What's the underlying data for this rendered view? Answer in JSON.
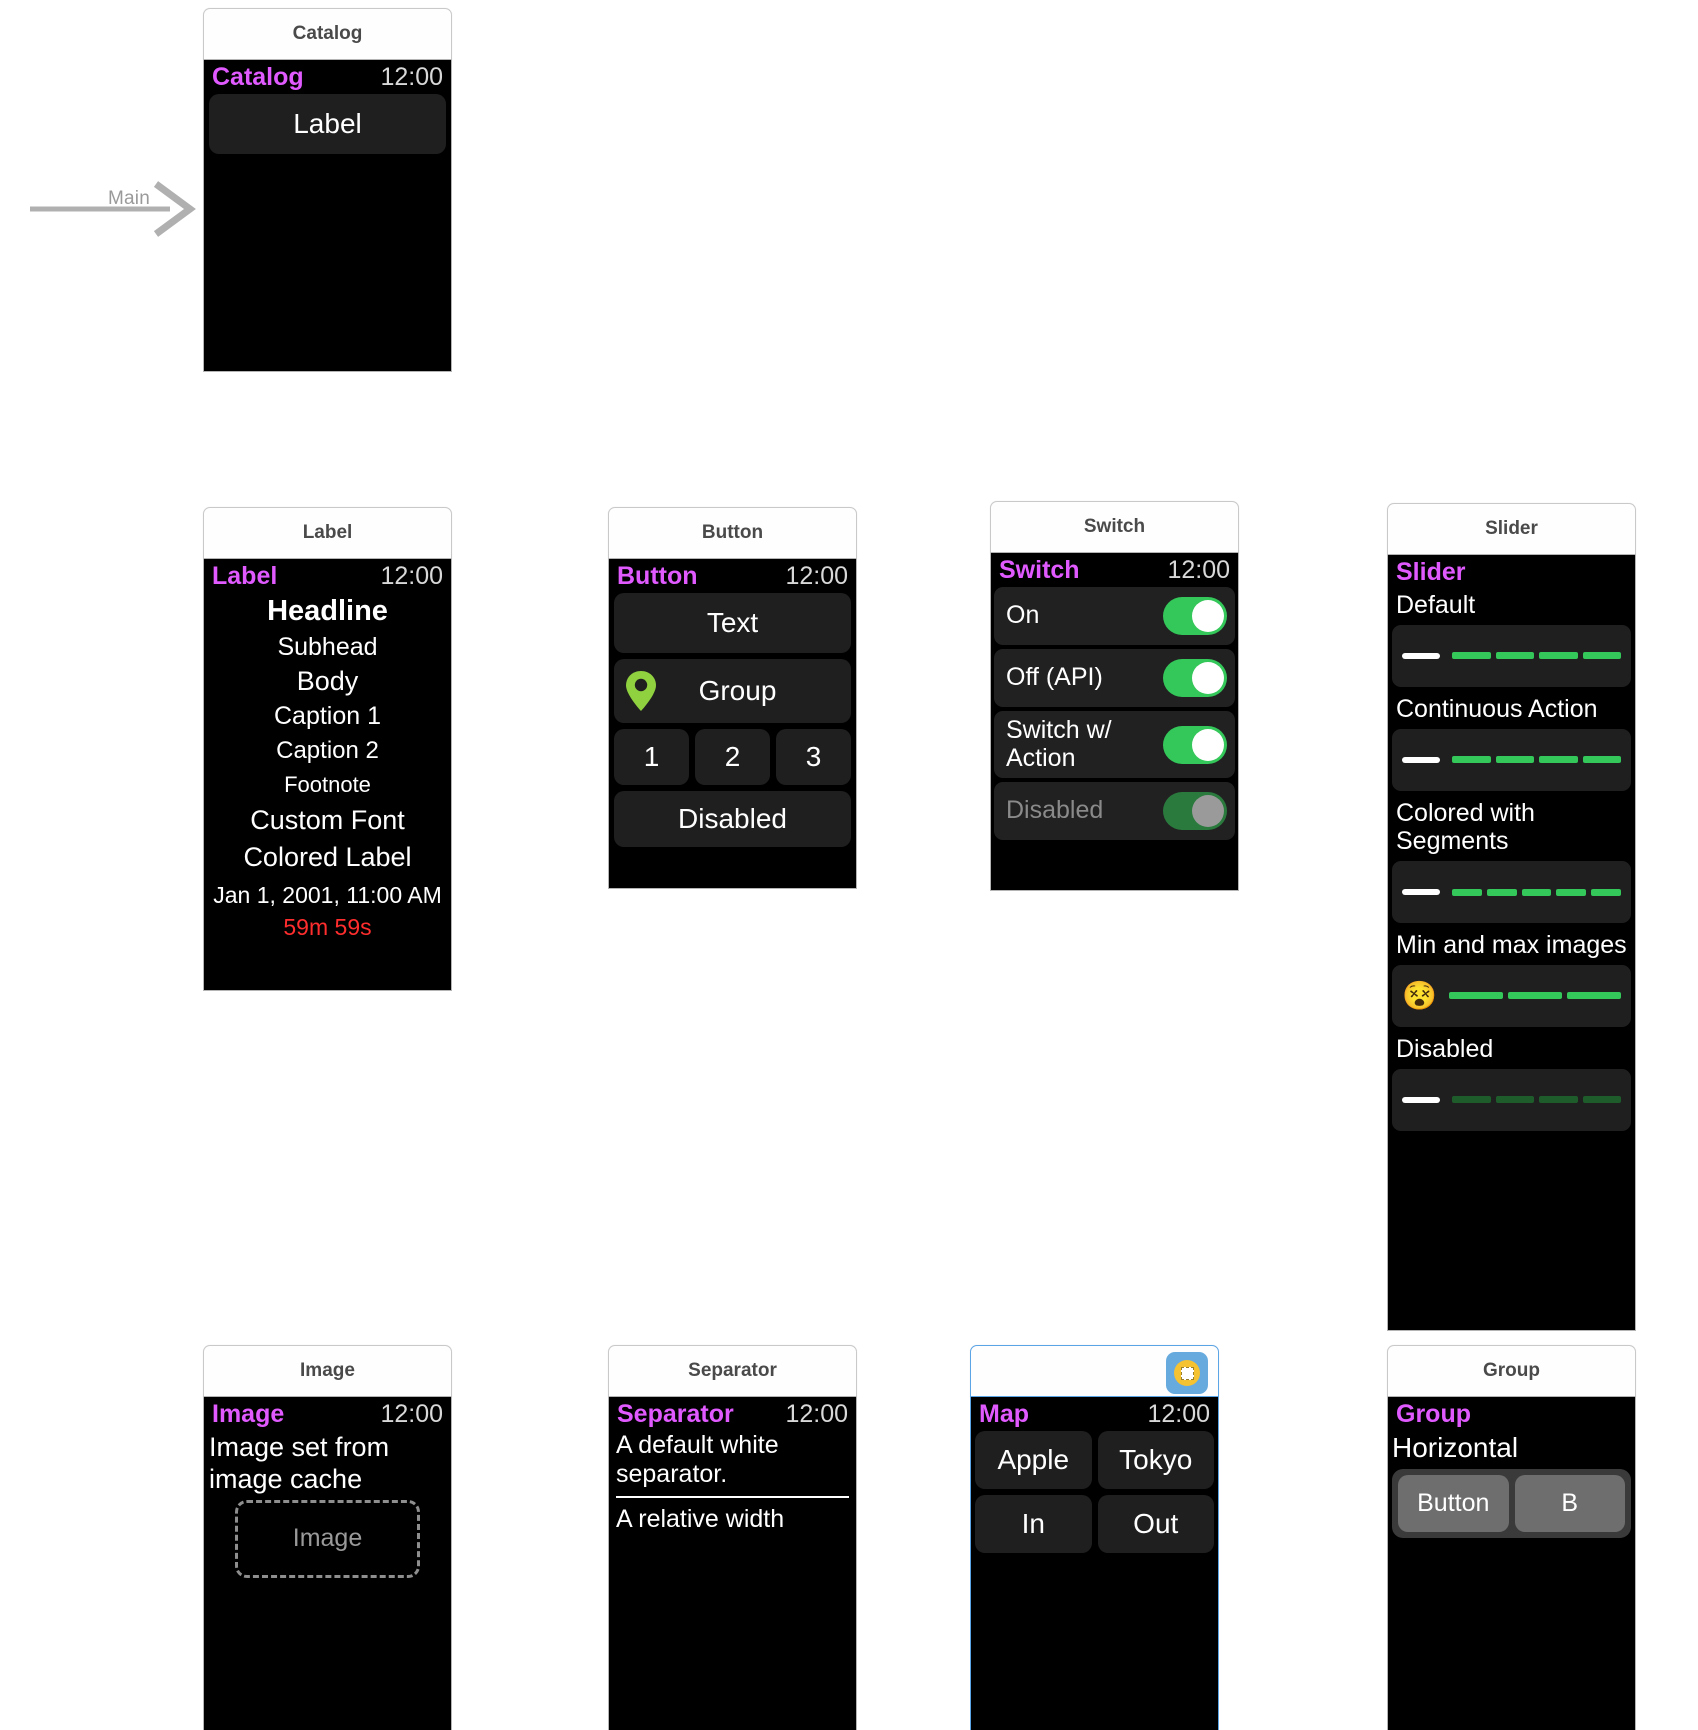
{
  "canvas": {
    "entry_point_label": "Main"
  },
  "scenes": [
    {
      "id": "catalog",
      "title": "Catalog",
      "app_name": "Catalog",
      "time": "12:00",
      "selected": false,
      "rows": [
        {
          "label": "Label"
        }
      ]
    },
    {
      "id": "label",
      "title": "Label",
      "app_name": "Label",
      "time": "12:00",
      "selected": false,
      "lines": [
        {
          "text": "Headline",
          "size": 29,
          "weight": "bold",
          "color": "#ffffff"
        },
        {
          "text": "Subhead",
          "size": 25,
          "weight": "normal",
          "color": "#ffffff"
        },
        {
          "text": "Body",
          "size": 27,
          "weight": "normal",
          "color": "#ffffff"
        },
        {
          "text": "Caption 1",
          "size": 25,
          "weight": "normal",
          "color": "#ffffff"
        },
        {
          "text": "Caption 2",
          "size": 24,
          "weight": "normal",
          "color": "#ffffff"
        },
        {
          "text": "Footnote",
          "size": 22,
          "weight": "normal",
          "color": "#ffffff"
        },
        {
          "text": "Custom Font",
          "size": 27,
          "weight": "normal",
          "color": "#ffffff"
        },
        {
          "text": "Colored Label",
          "size": 27,
          "weight": "normal",
          "color": "#ffffff"
        },
        {
          "text": "Jan 1, 2001, 11:00 AM",
          "size": 23,
          "weight": "normal",
          "color": "#ffffff"
        },
        {
          "text": "59m 59s",
          "size": 23,
          "weight": "normal",
          "color": "#ff2d2d"
        }
      ]
    },
    {
      "id": "button",
      "title": "Button",
      "app_name": "Button",
      "time": "12:00",
      "selected": false,
      "buttons": {
        "text": "Text",
        "group": "Group",
        "numbers": [
          "1",
          "2",
          "3"
        ],
        "disabled": "Disabled"
      },
      "icons": {
        "group_icon": "map-pin-icon"
      }
    },
    {
      "id": "switch",
      "title": "Switch",
      "app_name": "Switch",
      "time": "12:00",
      "selected": false,
      "switches": [
        {
          "label": "On",
          "on": true,
          "disabled": false
        },
        {
          "label": "Off (API)",
          "on": true,
          "disabled": false
        },
        {
          "label": "Switch w/ Action",
          "on": true,
          "disabled": false
        },
        {
          "label": "Disabled",
          "on": true,
          "disabled": true
        }
      ]
    },
    {
      "id": "slider",
      "title": "Slider",
      "app_name": "Slider",
      "time": "",
      "selected": false,
      "sliders": [
        {
          "caption": "Default",
          "lead": "minus",
          "segments": 4,
          "filled": 4,
          "dim": false
        },
        {
          "caption": "Continuous Action",
          "lead": "minus",
          "segments": 4,
          "filled": 4,
          "dim": false
        },
        {
          "caption": "Colored with Segments",
          "lead": "minus",
          "segments": 5,
          "filled": 5,
          "dim": false
        },
        {
          "caption": "Min and max images",
          "lead": "emoji",
          "emoji": "😵",
          "segments": 3,
          "filled": 3,
          "dim": false
        },
        {
          "caption": "Disabled",
          "lead": "minus",
          "segments": 4,
          "filled": 4,
          "dim": true
        }
      ]
    },
    {
      "id": "image",
      "title": "Image",
      "app_name": "Image",
      "time": "12:00",
      "selected": false,
      "caption": "Image set from image cache",
      "placeholder": "Image"
    },
    {
      "id": "separator",
      "title": "Separator",
      "app_name": "Separator",
      "time": "12:00",
      "selected": false,
      "paragraphs": [
        "A default white separator.",
        "A relative width"
      ]
    },
    {
      "id": "map",
      "title": "",
      "app_name": "Map",
      "time": "12:00",
      "selected": true,
      "badge_icon": "document-badge-icon",
      "buttons": [
        "Apple",
        "Tokyo",
        "In",
        "Out"
      ]
    },
    {
      "id": "group",
      "title": "Group",
      "app_name": "Group",
      "time": "",
      "selected": false,
      "caption": "Horizontal",
      "buttons": [
        "Button",
        "B"
      ]
    }
  ]
}
